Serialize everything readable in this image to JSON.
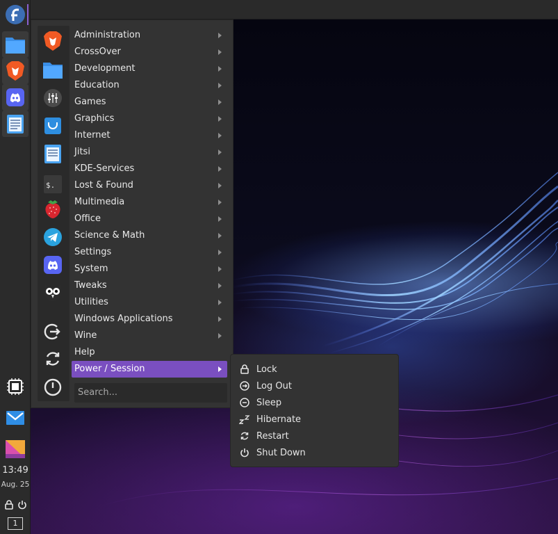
{
  "dock": {
    "clock_time": "13:49",
    "clock_date": "Aug. 25",
    "workspace_number": "1"
  },
  "menu": {
    "categories": [
      {
        "label": "Administration"
      },
      {
        "label": "CrossOver"
      },
      {
        "label": "Development"
      },
      {
        "label": "Education"
      },
      {
        "label": "Games"
      },
      {
        "label": "Graphics"
      },
      {
        "label": "Internet"
      },
      {
        "label": "Jitsi"
      },
      {
        "label": "KDE-Services"
      },
      {
        "label": "Lost & Found"
      },
      {
        "label": "Multimedia"
      },
      {
        "label": "Office"
      },
      {
        "label": "Science & Math"
      },
      {
        "label": "Settings"
      },
      {
        "label": "System"
      },
      {
        "label": "Tweaks"
      },
      {
        "label": "Utilities"
      },
      {
        "label": "Windows Applications"
      },
      {
        "label": "Wine"
      },
      {
        "label": "Help"
      },
      {
        "label": "Power / Session"
      }
    ],
    "search_placeholder": "Search..."
  },
  "power_submenu": {
    "items": [
      {
        "label": "Lock",
        "icon": "lock-icon"
      },
      {
        "label": "Log Out",
        "icon": "logout-icon"
      },
      {
        "label": "Sleep",
        "icon": "sleep-icon"
      },
      {
        "label": "Hibernate",
        "icon": "hibernate-icon"
      },
      {
        "label": "Restart",
        "icon": "restart-icon"
      },
      {
        "label": "Shut Down",
        "icon": "power-icon"
      }
    ]
  },
  "colors": {
    "accent": "#7a4fc0",
    "panel": "#333333",
    "dock": "#2b2b2b"
  }
}
